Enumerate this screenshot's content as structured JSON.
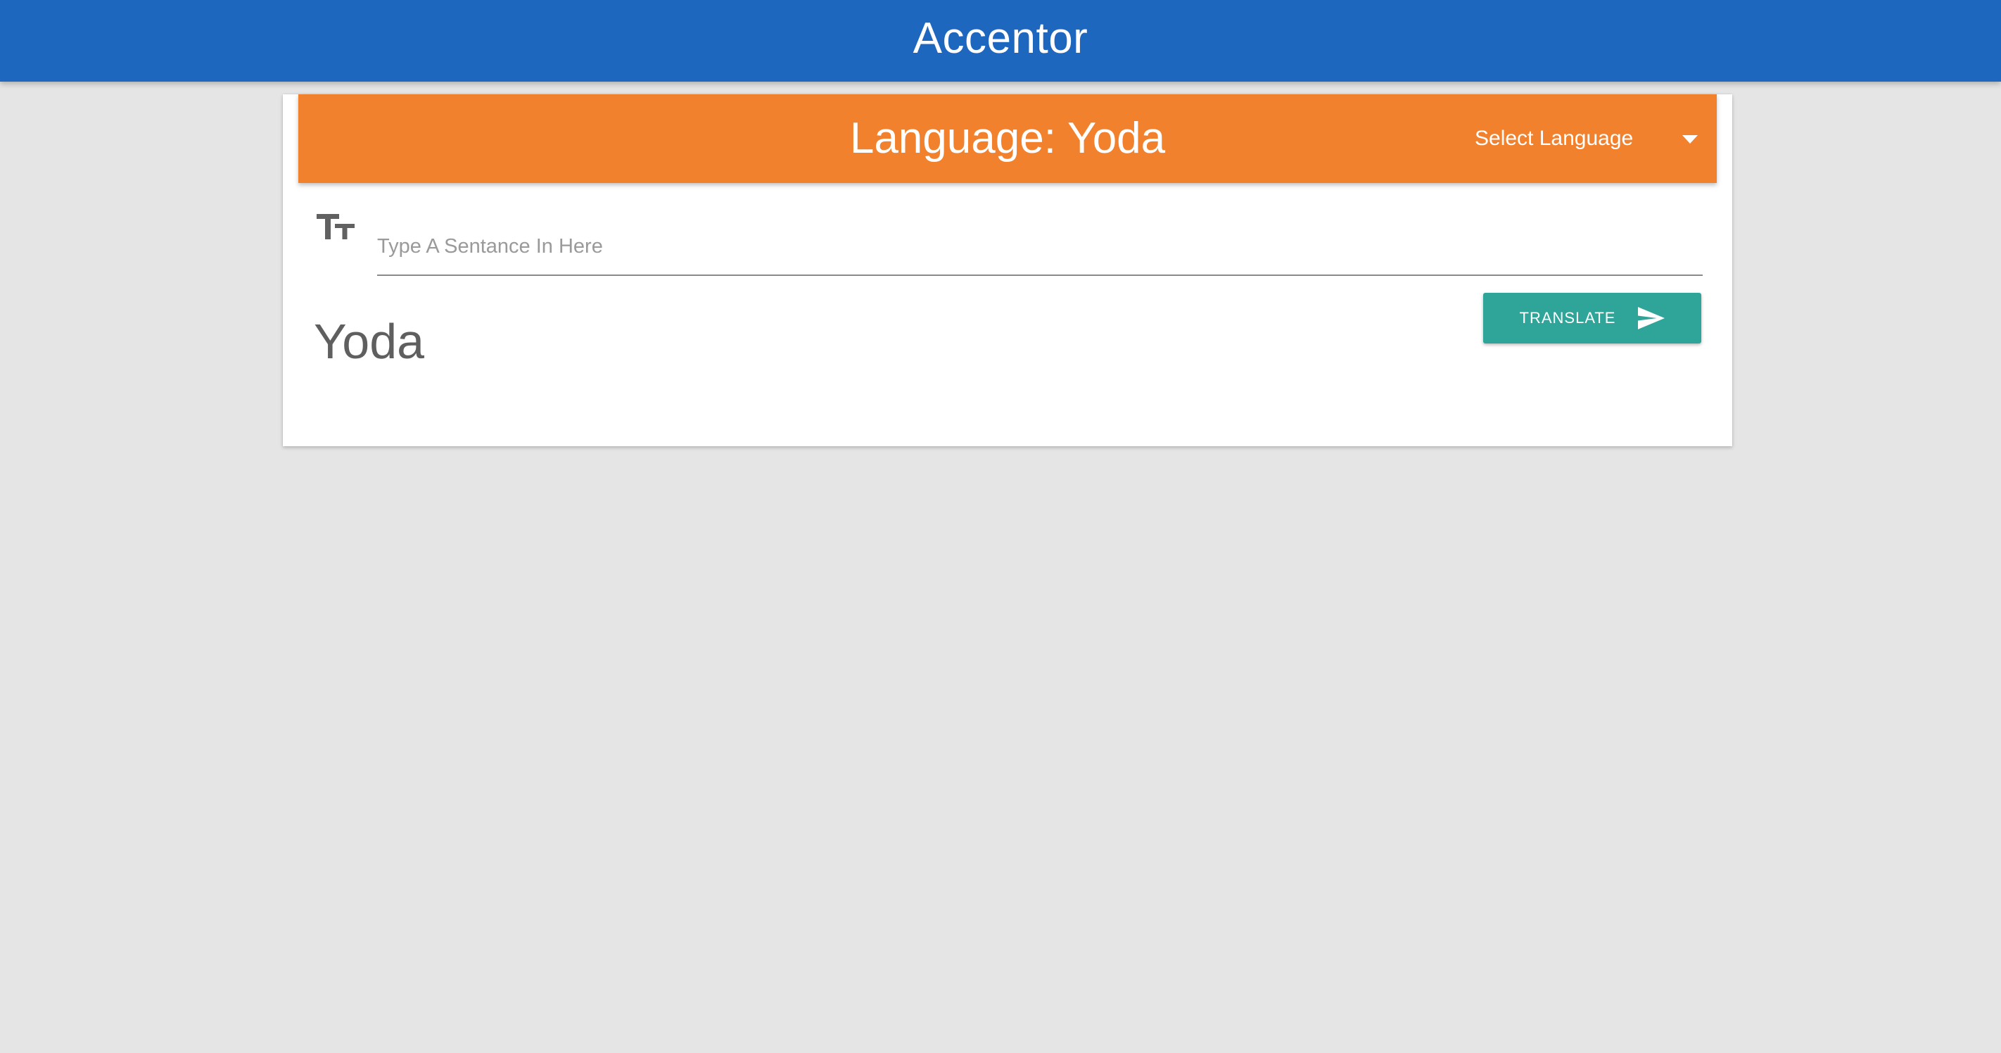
{
  "app": {
    "title": "Accentor"
  },
  "language_panel": {
    "title": "Language: Yoda",
    "select_label": "Select Language"
  },
  "input": {
    "placeholder": "Type A Sentance In Here",
    "value": "",
    "icon": "text-size-icon"
  },
  "output": {
    "text": "Yoda"
  },
  "translate_button": {
    "label": "TRANSLATE",
    "icon": "send-icon"
  },
  "colors": {
    "app_bar": "#1e67be",
    "language_header": "#f2812d",
    "translate_button": "#2fa59a",
    "background": "#e5e5e5"
  }
}
